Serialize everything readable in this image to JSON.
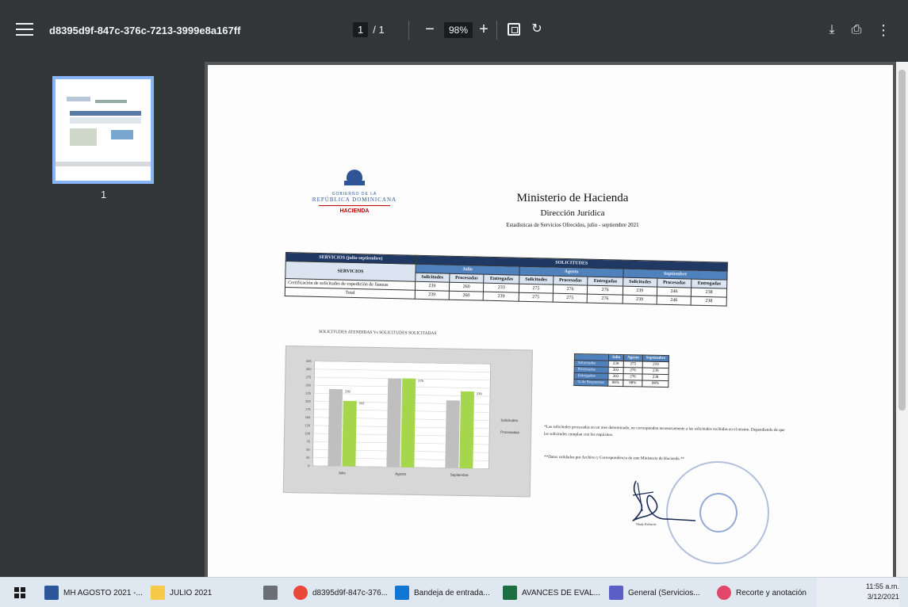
{
  "toolbar": {
    "title": "d8395d9f-847c-376c-7213-3999e8a167ff",
    "page_current": "1",
    "page_total": "/ 1",
    "zoom": "98%",
    "zoom_out": "−",
    "zoom_in": "+",
    "rotate_icon": "↻",
    "download_icon": "⤓",
    "print_icon": "⎙",
    "more_icon": "⋮"
  },
  "sidebar": {
    "thumbnail_label": "1"
  },
  "document": {
    "title": "Ministerio de Hacienda",
    "subtitle": "Dirección Jurídica",
    "description": "Estadísticas de Servicios Ofrecidos, julio - septiembre 2021",
    "logo": {
      "gov": "GOBIERNO DE LA",
      "republic": "REPÚBLICA DOMINICANA",
      "ministry": "HACIENDA"
    },
    "table": {
      "group_header": "SOLICITUDES",
      "left_header": "SERVICIOS (julio-septiembre)",
      "service_col": "SERVICIOS",
      "months": [
        "Julio",
        "Agosto",
        "Septiembre"
      ],
      "sub_headers": [
        "Solicitudes",
        "Procesadas",
        "Entregadas"
      ],
      "rows": [
        {
          "label": "Certificación de solicitudes de expedición de fianzas",
          "values": [
            "239",
            "260",
            "233",
            "275",
            "276",
            "276",
            "239",
            "246",
            "238"
          ]
        },
        {
          "label": "Total",
          "values": [
            "239",
            "260",
            "239",
            "275",
            "275",
            "276",
            "239",
            "246",
            "238"
          ]
        }
      ]
    },
    "chart_title": "SOLICITUDES ATENDIDAS Vs SOLICITUDES SOLICITADAS",
    "mini_table": {
      "headers": [
        "",
        "Julio",
        "Agosto",
        "Septiembre"
      ],
      "rows": [
        {
          "label": "Solicitudes",
          "values": [
            "239",
            "275",
            "210"
          ]
        },
        {
          "label": "Procesadas",
          "values": [
            "203",
            "276",
            "239"
          ]
        },
        {
          "label": "Entregadas",
          "values": [
            "203",
            "276",
            "238"
          ]
        },
        {
          "label": "% de Respuestas",
          "values": [
            "98%",
            "98%",
            "98%"
          ]
        }
      ]
    },
    "note1": "*Las solicitudes procesadas en un mes determinado, no corresponden necesariamente a las solicitudes recibidas en el mismo. Dependiendo de que las solicitudes cumplan con los requisitos.",
    "note2": "**Datos validados por Archivo y Correspondencia de este Ministerio de Hacienda.**",
    "signature_name": "Nhuly Richardo"
  },
  "chart_data": {
    "type": "bar",
    "categories": [
      "Julio",
      "Agosto",
      "Septiembre"
    ],
    "series": [
      {
        "name": "Solicitudes",
        "values": [
          239,
          275,
          210
        ],
        "color": "#bfbfbf"
      },
      {
        "name": "Procesadas",
        "values": [
          203,
          276,
          239
        ],
        "color": "#a5d64c"
      }
    ],
    "data_labels": [
      [
        "239",
        "203"
      ],
      [
        "275",
        "276"
      ],
      [
        "210",
        "239"
      ]
    ],
    "ylim": [
      0,
      325
    ],
    "yticks": [
      0,
      25,
      50,
      75,
      100,
      125,
      150,
      175,
      200,
      225,
      250,
      275,
      300,
      325
    ],
    "legend": [
      "Solicitudes",
      "Procesadas"
    ],
    "legend_position": "right"
  },
  "taskbar": {
    "items": [
      {
        "label": "MH AGOSTO 2021 -..."
      },
      {
        "label": "JULIO 2021"
      },
      {
        "label": "d8395d9f-847c-376..."
      },
      {
        "label": "Bandeja de entrada..."
      },
      {
        "label": "AVANCES DE EVAL..."
      },
      {
        "label": "General (Servicios..."
      },
      {
        "label": "Recorte y anotación"
      }
    ],
    "time": "11:55 a.m.",
    "date": "3/12/2021"
  }
}
